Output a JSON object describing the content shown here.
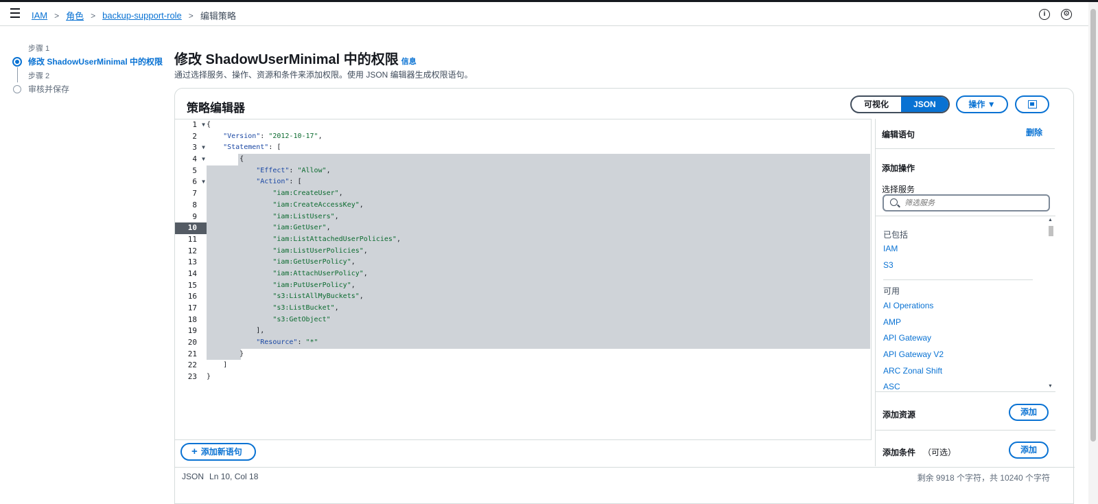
{
  "breadcrumb": {
    "items": [
      "IAM",
      "角色",
      "backup-support-role"
    ],
    "current": "编辑策略"
  },
  "top_icons": {
    "info": "info-icon",
    "settings": "settings-icon",
    "info_glyph": "i",
    "settings_glyph": "⚙"
  },
  "wizard": {
    "step1_sub": "步骤 1",
    "step1_label": "修改 ShadowUserMinimal 中的权限",
    "step2_sub": "步骤 2",
    "step2_label": "审核并保存"
  },
  "header": {
    "title": "修改 ShadowUserMinimal 中的权限",
    "info": "信息",
    "description": "通过选择服务、操作、资源和条件来添加权限。使用 JSON 编辑器生成权限语句。"
  },
  "panel": {
    "title": "策略编辑器",
    "toggle_visual": "可视化",
    "toggle_json": "JSON",
    "actions_label": "操作 ▼",
    "active_line": 10
  },
  "code_lines": [
    "{",
    "    \"Version\": \"2012-10-17\",",
    "    \"Statement\": [",
    "        {",
    "            \"Effect\": \"Allow\",",
    "            \"Action\": [",
    "                \"iam:CreateUser\",",
    "                \"iam:CreateAccessKey\",",
    "                \"iam:ListUsers\",",
    "                \"iam:GetUser\",",
    "                \"iam:ListAttachedUserPolicies\",",
    "                \"iam:ListUserPolicies\",",
    "                \"iam:GetUserPolicy\",",
    "                \"iam:AttachUserPolicy\",",
    "                \"iam:PutUserPolicy\",",
    "                \"s3:ListAllMyBuckets\",",
    "                \"s3:ListBucket\",",
    "                \"s3:GetObject\"",
    "            ],",
    "            \"Resource\": \"*\"",
    "        }",
    "    ]",
    "}"
  ],
  "fold_lines": [
    1,
    3,
    4,
    6
  ],
  "footer": {
    "add_statement": "添加新语句",
    "mode": "JSON",
    "cursor": "Ln 10, Col 18",
    "chars": "剩余 9918 个字符，共 10240 个字符"
  },
  "side": {
    "edit_statement": "编辑语句",
    "delete": "删除",
    "add_actions": "添加操作",
    "select_service": "选择服务",
    "search_placeholder": "筛选服务",
    "included_label": "已包括",
    "included": [
      "IAM",
      "S3"
    ],
    "available_label": "可用",
    "available": [
      "AI Operations",
      "AMP",
      "API Gateway",
      "API Gateway V2",
      "ARC Zonal Shift",
      "ASC"
    ],
    "add_resource": "添加资源",
    "add_condition": "添加条件",
    "optional": "（可选）",
    "add_button": "添加"
  },
  "colors": {
    "accent": "#0972d3",
    "selection": "#cfd3d8",
    "string": "#0a6a2e",
    "key": "#1a47a3"
  }
}
